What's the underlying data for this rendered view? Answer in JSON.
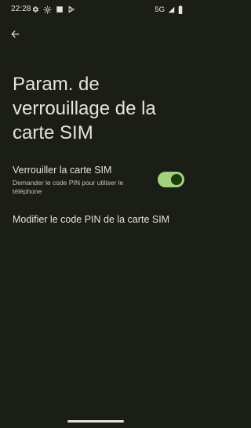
{
  "status_bar": {
    "time": "22:28",
    "network": "5G",
    "left_icons": [
      "gear-icon",
      "brightness-icon",
      "image-icon",
      "play-store-icon"
    ],
    "right_icons": [
      "signal-icon",
      "battery-icon"
    ]
  },
  "header": {
    "back_icon": "arrow-back-icon"
  },
  "page": {
    "title": "Param. de verrouillage de la carte SIM"
  },
  "settings": {
    "lock_sim": {
      "title": "Verrouiller la carte SIM",
      "summary": "Demander le code PIN pour utiliser le téléphone",
      "enabled": true
    },
    "change_pin": {
      "label": "Modifier le code PIN de la carte SIM"
    }
  },
  "colors": {
    "background": "#1b1d17",
    "text_primary": "#e4e6dc",
    "text_secondary": "#c4c7bb",
    "toggle_track_on": "#a3d27f",
    "toggle_thumb_on": "#1f3a0c"
  }
}
